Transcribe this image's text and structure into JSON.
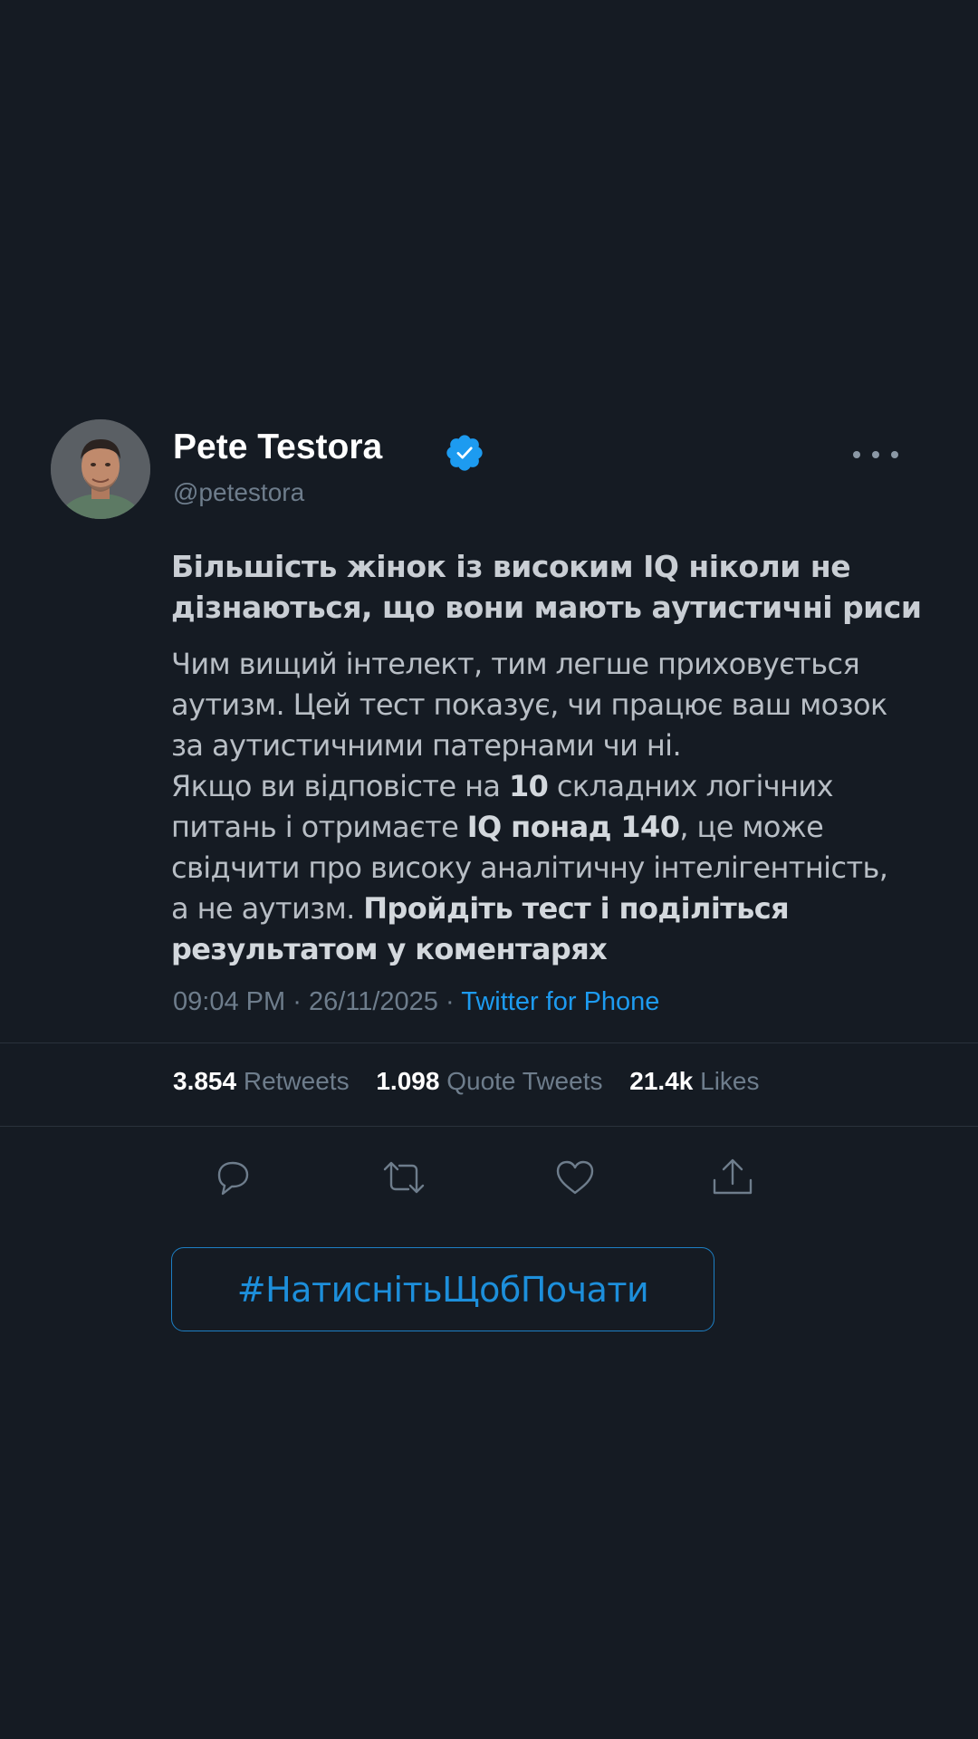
{
  "author": {
    "display_name": "Pete Testora",
    "handle": "@petestora",
    "verified": true
  },
  "tweet": {
    "headline": "Більшість жінок із високим IQ ніколи не дізнаються, що вони мають аутистичні риси",
    "body_lines": [
      "Чим вищий інтелект, тим легше приховується",
      "аутизм. Цей тест показує, чи працює ваш мозок",
      "за аутистичними патернами чи ні."
    ],
    "body_line4_a": "Якщо ви відповісте на ",
    "body_line4_b": "10",
    "body_line4_c": " складних логічних",
    "body_line5_a": "питань і отримаєте ",
    "body_line5_b": "IQ понад 140",
    "body_line5_c": ", це може",
    "body_line6": "свідчити про високу аналітичну інтелігентність,",
    "body_line7_a": "а не аутизм. ",
    "body_line7_b": "Пройдіть тест і поділіться",
    "body_line8": "результатом у коментарях",
    "time": "09:04 PM",
    "date": "26/11/2025",
    "separator": "·",
    "source": "Twitter for Phone"
  },
  "stats": {
    "retweets_count": "3.854",
    "retweets_label": "Retweets",
    "quotes_count": "1.098",
    "quotes_label": "Quote Tweets",
    "likes_count": "21.4k",
    "likes_label": "Likes"
  },
  "actions": [
    "reply-icon",
    "retweet-icon",
    "like-icon",
    "share-icon"
  ],
  "cta": {
    "label": "#НатиснітьЩобПочати"
  },
  "colors": {
    "background": "#151b23",
    "accent": "#1d9bf0",
    "verified": "#1d9bf0",
    "muted": "#6e7d8c"
  }
}
